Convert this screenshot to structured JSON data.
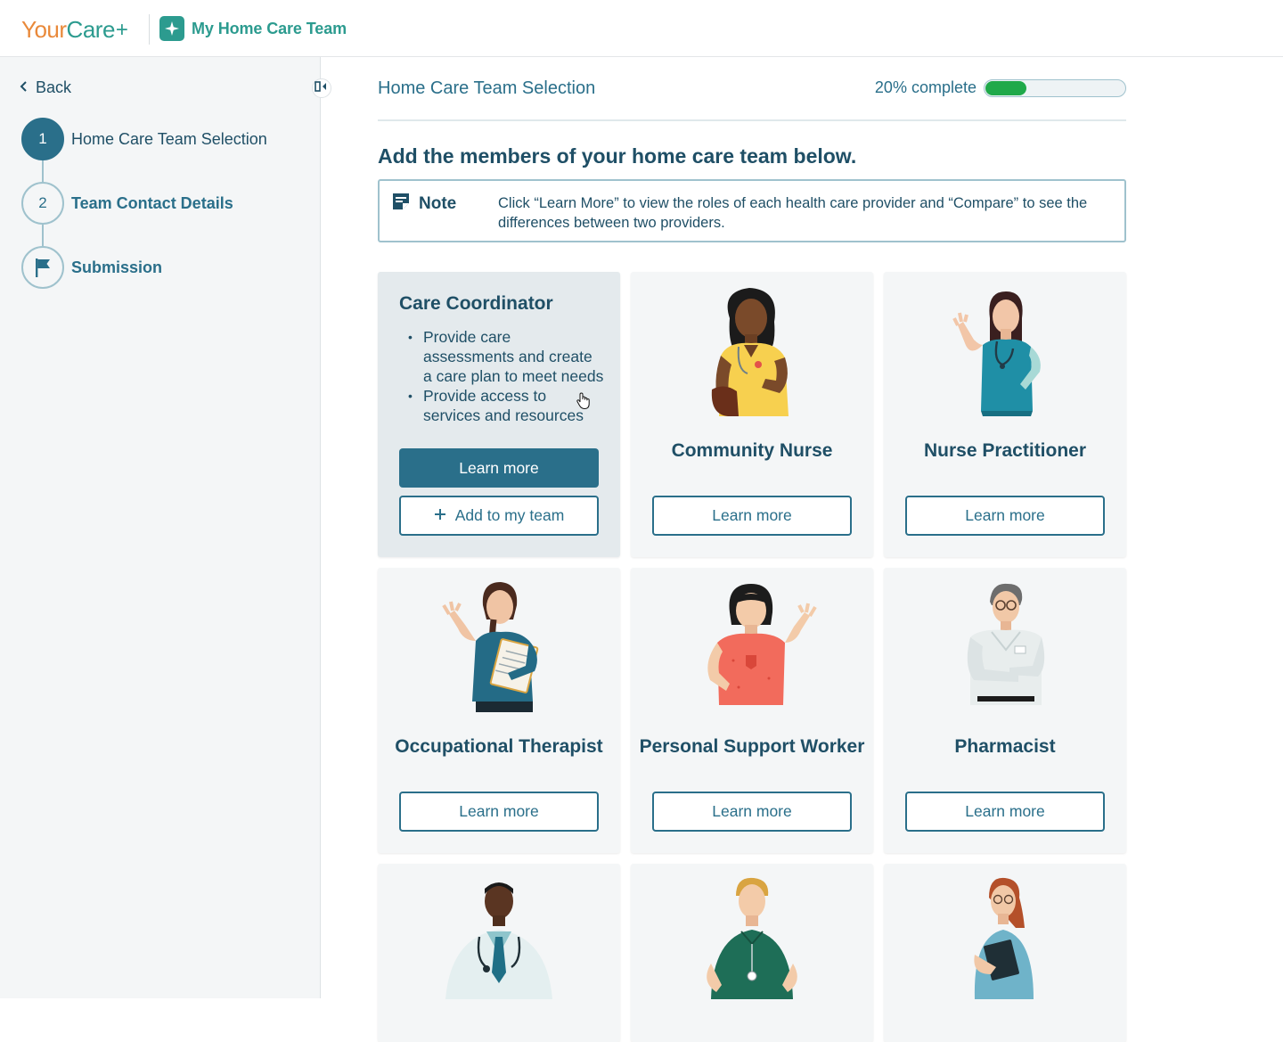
{
  "header": {
    "brand_your": "Your",
    "brand_care": "Care",
    "brand_plus": "+",
    "app_title": "My Home Care Team"
  },
  "sidebar": {
    "back_label": "Back",
    "steps": [
      {
        "marker": "1",
        "label": "Home Care Team Selection",
        "state": "active"
      },
      {
        "marker": "2",
        "label": "Team Contact Details",
        "state": "upcoming"
      },
      {
        "marker": "flag-icon",
        "label": "Submission",
        "state": "upcoming"
      }
    ]
  },
  "main": {
    "page_title": "Home Care Team Selection",
    "progress_text": "20% complete",
    "progress_value": 0.2,
    "heading": "Add the members of your home care team below.",
    "note": {
      "label": "Note",
      "text": "Click “Learn More” to view the roles of each health care provider and “Compare” to see the differences between two providers."
    },
    "cards": [
      {
        "name": "Care Coordinator",
        "state": "expanded",
        "bullets": [
          "Provide care assessments and create a care plan to meet needs",
          "Provide access to services and resources"
        ],
        "learn_more": "Learn more",
        "add_label": "Add to my team"
      },
      {
        "name": "Community Nurse",
        "learn_more": "Learn more"
      },
      {
        "name": "Nurse Practitioner",
        "learn_more": "Learn more"
      },
      {
        "name": "Occupational Therapist",
        "learn_more": "Learn more"
      },
      {
        "name": "Personal Support Worker",
        "learn_more": "Learn more"
      },
      {
        "name": "Pharmacist",
        "learn_more": "Learn more"
      },
      {
        "name": "",
        "learn_more": ""
      },
      {
        "name": "",
        "learn_more": ""
      },
      {
        "name": "",
        "learn_more": ""
      }
    ]
  },
  "colors": {
    "primary": "#2a6f8a",
    "brand_orange": "#e9893a",
    "brand_teal": "#2c9b8f",
    "progress_green": "#20a94a",
    "sidebar_bg": "#f4f6f7"
  }
}
